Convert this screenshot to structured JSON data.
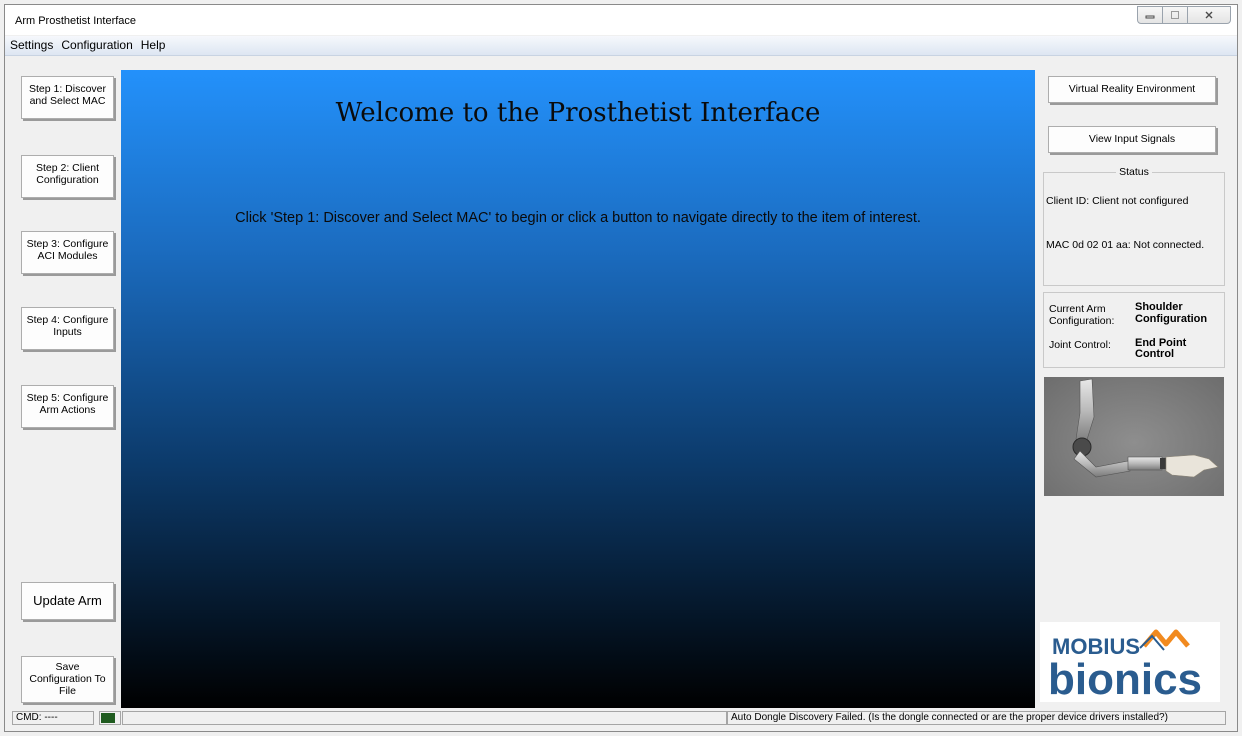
{
  "window": {
    "title": "Arm Prosthetist Interface"
  },
  "menu": [
    "Settings",
    "Configuration",
    "Help"
  ],
  "steps": [
    {
      "line1": "Step 1: Discover",
      "line2": "and Select MAC"
    },
    {
      "line1": "Step 2: Client",
      "line2": "Configuration"
    },
    {
      "line1": "Step 3: Configure",
      "line2": "ACI Modules"
    },
    {
      "line1": "Step 4: Configure",
      "line2": "Inputs"
    },
    {
      "line1": "Step 5: Configure",
      "line2": "Arm Actions"
    }
  ],
  "left_bottom": {
    "update_label": "Update Arm",
    "save_line1": "Save",
    "save_line2": "Configuration To",
    "save_line3": "File"
  },
  "main": {
    "welcome": "Welcome to the Prosthetist Interface",
    "instruction": "Click 'Step 1: Discover and Select MAC' to begin or click a button to navigate directly to the item of interest.",
    "gradient_top": "#2391fb",
    "gradient_bottom": "#000000"
  },
  "right": {
    "vr_label": "Virtual Reality Environment",
    "signals_label": "View Input Signals",
    "status": {
      "legend": "Status",
      "client": "Client ID: Client not configured",
      "mac": "MAC 0d 02 01 aa: Not connected."
    },
    "arm": {
      "config_label_1": "Current Arm",
      "config_label_2": "Configuration:",
      "config_value_1": "Shoulder",
      "config_value_2": "Configuration",
      "joint_label": "Joint Control:",
      "joint_value_1": "End Point",
      "joint_value_2": "Control"
    },
    "logo": {
      "word1": "MOBIUS",
      "word2": "bionics",
      "color": "#2a5c8f",
      "accent": "#f18a1f"
    }
  },
  "statusbar": {
    "cmd": "CMD: ----",
    "indicator_color": "#1f5b1f",
    "message": "Auto Dongle Discovery Failed. (Is the dongle connected or are the proper device drivers installed?)"
  }
}
